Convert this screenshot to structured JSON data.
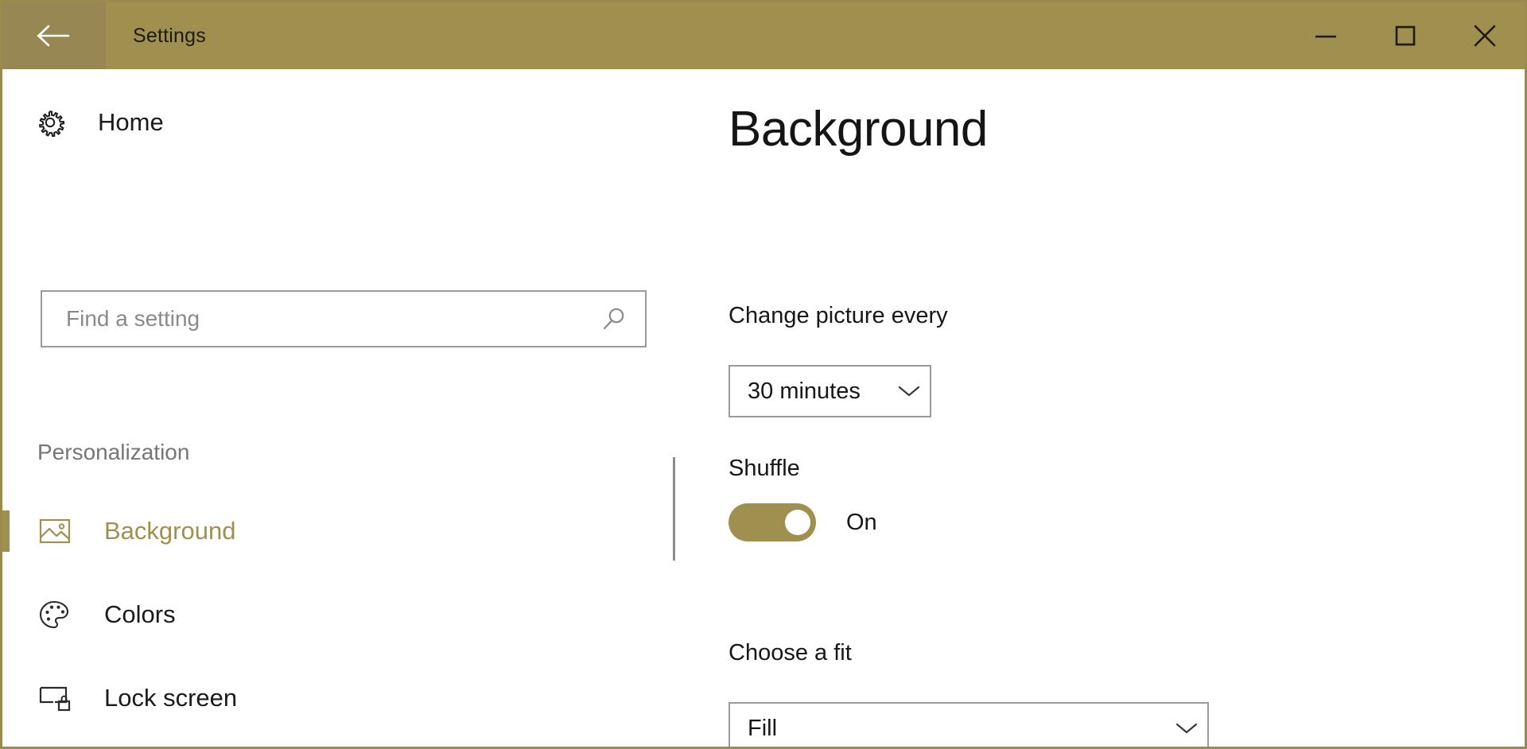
{
  "window": {
    "title": "Settings",
    "back_icon": "back-arrow-icon",
    "controls": {
      "minimize": "minimize-icon",
      "maximize": "maximize-icon",
      "close": "close-icon"
    }
  },
  "colors": {
    "accent": "#a0904f",
    "titlebar": "#a0904f",
    "back_button": "#978853",
    "border": "#9b8a4d",
    "text": "#171717",
    "muted_text": "#767676",
    "field_border": "#9a9a9a"
  },
  "sidebar": {
    "home": {
      "label": "Home",
      "icon": "gear-icon"
    },
    "search": {
      "placeholder": "Find a setting",
      "value": "",
      "icon": "search-icon"
    },
    "section_label": "Personalization",
    "items": [
      {
        "label": "Background",
        "icon": "picture-icon",
        "selected": true
      },
      {
        "label": "Colors",
        "icon": "palette-icon",
        "selected": false
      },
      {
        "label": "Lock screen",
        "icon": "lock-screen-icon",
        "selected": false
      }
    ]
  },
  "main": {
    "title": "Background",
    "fields": {
      "change_picture_every": {
        "label": "Change picture every",
        "value": "30 minutes",
        "chevron": "chevron-down-icon"
      },
      "shuffle": {
        "label": "Shuffle",
        "state": "On",
        "toggle_on": true
      },
      "choose_a_fit": {
        "label": "Choose a fit",
        "value": "Fill",
        "chevron": "chevron-down-icon"
      }
    }
  }
}
